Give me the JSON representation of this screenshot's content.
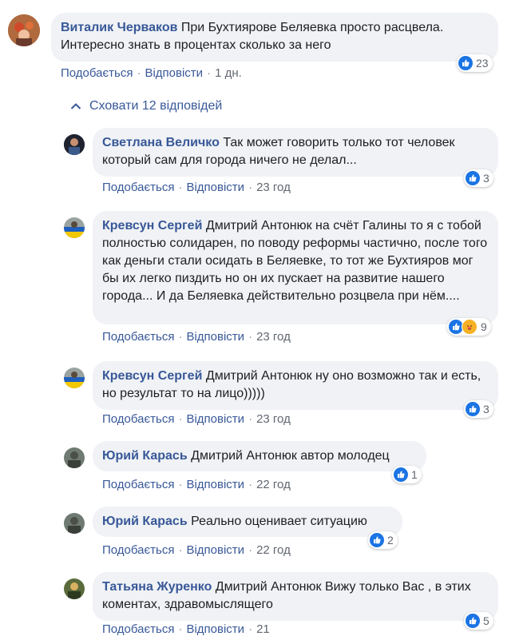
{
  "colors": {
    "link": "#385898",
    "bubble": "#f0f2f5",
    "like": "#1b74e4",
    "muted": "#616770"
  },
  "main_comment": {
    "author": "Виталик Черваков",
    "text": "При Бухтиярове Беляевка просто расцвела. Интересно знать в процентах сколько за него",
    "like_label": "Подобається",
    "reply_label": "Відповісти",
    "time": "1 дн.",
    "reactions": "23"
  },
  "toggle": {
    "label": "Сховати 12 відповідей",
    "icon": "chevron-up-icon"
  },
  "replies": [
    {
      "author": "Светлана Величко",
      "text": "Так может говорить только тот человек который сам для города ничего не делал...",
      "like_label": "Подобається",
      "reply_label": "Відповісти",
      "time": "23 год",
      "reactions": "3"
    },
    {
      "author": "Кревсун Сергей",
      "text": "Дмитрий Антонюк на счёт Галины то я с тобой полностью солидарен, по поводу реформы частично, после того как деньги стали осидать в Беляевке, то тот же Бухтияров мог бы их легко пиздить но он их пускает на развитие нашего города... И да Беляевка действительно розцвела при нём....",
      "like_label": "Подобається",
      "reply_label": "Відповісти",
      "time": "23 год",
      "reactions": "9"
    },
    {
      "author": "Кревсун Сергей",
      "text": "Дмитрий Антонюк ну оно возможно так и есть, но результат то на лицо)))))",
      "like_label": "Подобається",
      "reply_label": "Відповісти",
      "time": "23 год",
      "reactions": "3"
    },
    {
      "author": "Юрий Карась",
      "text": "Дмитрий Антонюк автор молодец",
      "like_label": "Подобається",
      "reply_label": "Відповісти",
      "time": "22 год",
      "reactions": "1"
    },
    {
      "author": "Юрий Карась",
      "text": "Реально оценивает ситуацию",
      "like_label": "Подобається",
      "reply_label": "Відповісти",
      "time": "22 год",
      "reactions": "2"
    },
    {
      "author": "Татьяна Журенко",
      "text": "Дмитрий Антонюк Вижу только Вас , в этих коментах, здравомыслящего",
      "like_label": "Подобається",
      "reply_label": "Відповісти",
      "time": "21",
      "reactions": "5"
    }
  ]
}
